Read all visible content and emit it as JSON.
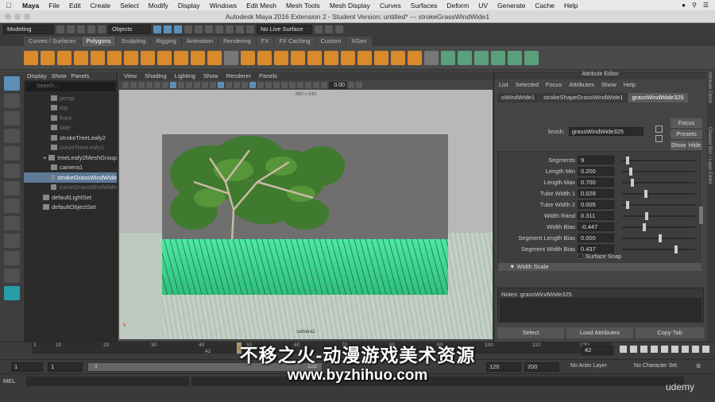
{
  "menubar": {
    "app": "Maya",
    "items": [
      "File",
      "Edit",
      "Create",
      "Select",
      "Modify",
      "Display",
      "Windows",
      "Edit Mesh",
      "Mesh Tools",
      "Mesh Display",
      "Curves",
      "Surfaces",
      "Deform",
      "UV",
      "Generate",
      "Cache",
      "Help"
    ]
  },
  "window": {
    "title": "Autodesk Maya 2016 Extension 2 - Student Version: untitled*   ---   strokeGrassWindWide1"
  },
  "toolbar": {
    "mode": "Modeling",
    "objects": "Objects",
    "live_surface": "No Live Surface"
  },
  "shelf_tabs": [
    "Curves / Surfaces",
    "Polygons",
    "Sculpting",
    "Rigging",
    "Animation",
    "Rendering",
    "FX",
    "FX Caching",
    "Custom",
    "XGen"
  ],
  "shelf_active": "Polygons",
  "outliner": {
    "menu": [
      "Display",
      "Show",
      "Panels"
    ],
    "search_placeholder": "Search...",
    "items": [
      {
        "label": "persp",
        "dim": true
      },
      {
        "label": "top",
        "dim": true
      },
      {
        "label": "front",
        "dim": true
      },
      {
        "label": "side",
        "dim": true
      },
      {
        "label": "strokeTreeLeafy2",
        "dim": false
      },
      {
        "label": "curveTreeLeafy1",
        "dim": true
      },
      {
        "label": "treeLeafy2MeshGroup",
        "dim": false
      },
      {
        "label": "camera1",
        "dim": false
      },
      {
        "label": "strokeGrassWindWide",
        "dim": false,
        "selected": true
      },
      {
        "label": "curveGrassWindWide",
        "dim": true
      },
      {
        "label": "defaultLightSet",
        "dim": false
      },
      {
        "label": "defaultObjectSet",
        "dim": false
      }
    ]
  },
  "viewport": {
    "menu": [
      "View",
      "Shading",
      "Lighting",
      "Show",
      "Renderer",
      "Panels"
    ],
    "resolution": "960 x 540",
    "frame_value": "0.00",
    "camera_label": "camera1"
  },
  "attribute_editor": {
    "title": "Attribute Editor",
    "menu": [
      "List",
      "Selected",
      "Focus",
      "Attributes",
      "Show",
      "Help"
    ],
    "tabs": [
      "sWindWide1",
      "strokeShapeGrassWindWide1",
      "grassWindWide325"
    ],
    "active_tab": "grassWindWide325",
    "brush_label": "brush:",
    "brush_value": "grassWindWide325",
    "buttons": {
      "focus": "Focus",
      "presets": "Presets",
      "show": "Show",
      "hide": "Hide"
    },
    "attributes": [
      {
        "label": "Segments",
        "value": "9",
        "slider": 0.05
      },
      {
        "label": "Length Min",
        "value": "0.200",
        "slider": 0.1
      },
      {
        "label": "Length Max",
        "value": "0.700",
        "slider": 0.12
      },
      {
        "label": "Tube Width 1",
        "value": "0.028",
        "slider": 0.3
      },
      {
        "label": "Tube Width 2",
        "value": "0.005",
        "slider": 0.05
      },
      {
        "label": "Width Rand",
        "value": "0.311",
        "slider": 0.31
      },
      {
        "label": "Width Bias",
        "value": "-0.447",
        "slider": 0.28
      },
      {
        "label": "Segment Length Bias",
        "value": "0.000",
        "slider": 0.5
      },
      {
        "label": "Segment Width Bias",
        "value": "0.437",
        "slider": 0.72
      }
    ],
    "surface_snap": "Surface Snap",
    "width_scale": "Width Scale",
    "notes_label": "Notes:  grassWindWide325",
    "bottom_buttons": [
      "Select",
      "Load Attributes",
      "Copy Tab"
    ]
  },
  "side_tabs": [
    "Attribute Editor",
    "Channel Box / Layer Editor"
  ],
  "timeline": {
    "ticks": [
      "1",
      "10",
      "20",
      "30",
      "40",
      "50",
      "60",
      "70",
      "80",
      "90",
      "100",
      "110",
      "120"
    ],
    "current_frame_marker": "42",
    "current_frame": "42"
  },
  "range": {
    "start": "1",
    "start2": "1",
    "bar_start": "1",
    "bar_end": "120",
    "end": "120",
    "end2": "200",
    "anim_layer": "No Anim Layer",
    "char_set": "No Character Set"
  },
  "cmdline": {
    "label": "MEL"
  },
  "watermark": {
    "line1": "不移之火-动漫游戏美术资源",
    "line2": "www.byzhihuo.com",
    "brand": "udemy"
  },
  "colors": {
    "selection": "#5d7a96",
    "grass": "#4de8a6",
    "accent": "#5b8fb8"
  }
}
